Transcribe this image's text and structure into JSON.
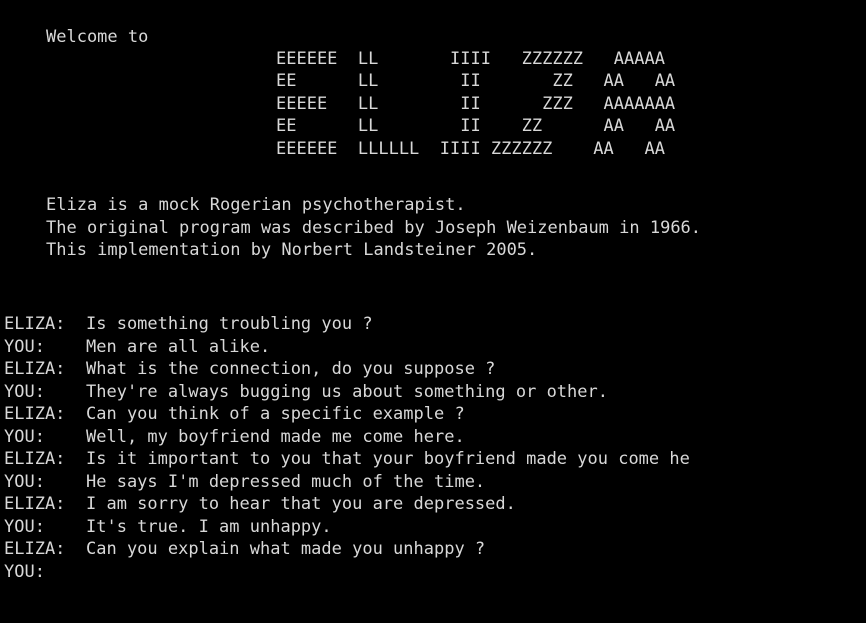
{
  "welcome": "Welcome to",
  "banner": [
    "EEEEEE  LL       IIII   ZZZZZZ   AAAAA",
    "EE      LL        II       ZZ   AA   AA",
    "EEEEE   LL        II      ZZZ   AAAAAAA",
    "EE      LL        II    ZZ      AA   AA",
    "EEEEEE  LLLLLL  IIII ZZZZZZ    AA   AA"
  ],
  "info": [
    "Eliza is a mock Rogerian psychotherapist.",
    "The original program was described by Joseph Weizenbaum in 1966.",
    "This implementation by Norbert Landsteiner 2005."
  ],
  "dialog": [
    {
      "speaker": "ELIZA:",
      "text": "Is something troubling you ?"
    },
    {
      "speaker": "YOU:",
      "text": "Men are all alike."
    },
    {
      "speaker": "ELIZA:",
      "text": "What is the connection, do you suppose ?"
    },
    {
      "speaker": "YOU:",
      "text": "They're always bugging us about something or other."
    },
    {
      "speaker": "ELIZA:",
      "text": "Can you think of a specific example ?"
    },
    {
      "speaker": "YOU:",
      "text": "Well, my boyfriend made me come here."
    },
    {
      "speaker": "ELIZA:",
      "text": "Is it important to you that your boyfriend made you come he"
    },
    {
      "speaker": "YOU:",
      "text": "He says I'm depressed much of the time."
    },
    {
      "speaker": "ELIZA:",
      "text": "I am sorry to hear that you are depressed."
    },
    {
      "speaker": "YOU:",
      "text": "It's true. I am unhappy."
    },
    {
      "speaker": "ELIZA:",
      "text": "Can you explain what made you unhappy ?"
    },
    {
      "speaker": "YOU:",
      "text": ""
    }
  ]
}
